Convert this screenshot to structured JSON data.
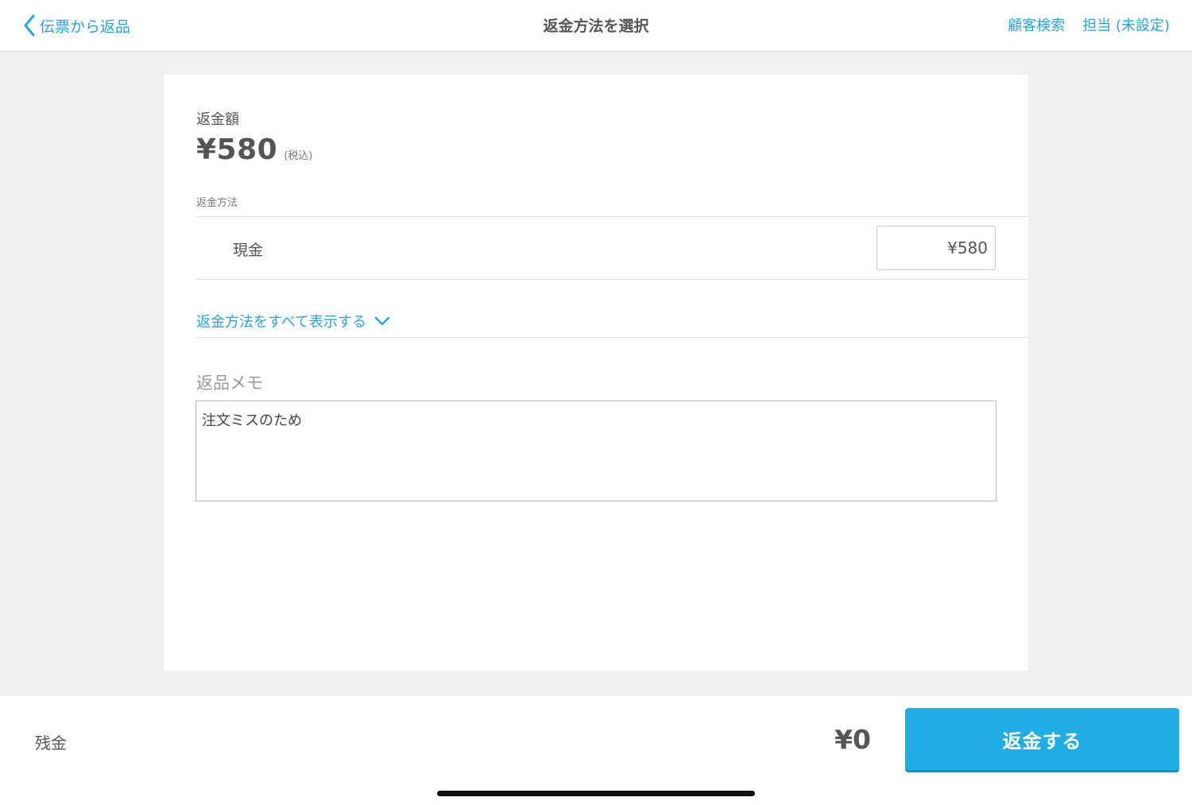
{
  "navbar": {
    "back_label": "伝票から返品",
    "title": "返金方法を選択",
    "customer_search_label": "顧客検索",
    "staff_label": "担当 (未設定)"
  },
  "refund": {
    "amount_label": "返金額",
    "amount_value": "¥580",
    "tax_note": "(税込)",
    "method_section_label": "返金方法",
    "method_name": "現金",
    "method_amount": "¥580",
    "show_all_label": "返金方法をすべて表示する"
  },
  "memo": {
    "label": "返品メモ",
    "value": "注文ミスのため"
  },
  "footer": {
    "balance_label": "残金",
    "balance_value": "¥0",
    "refund_button_label": "返金する"
  },
  "colors": {
    "accent": "#2aa3d8",
    "button": "#23ace3",
    "background": "#f0f0f0"
  }
}
